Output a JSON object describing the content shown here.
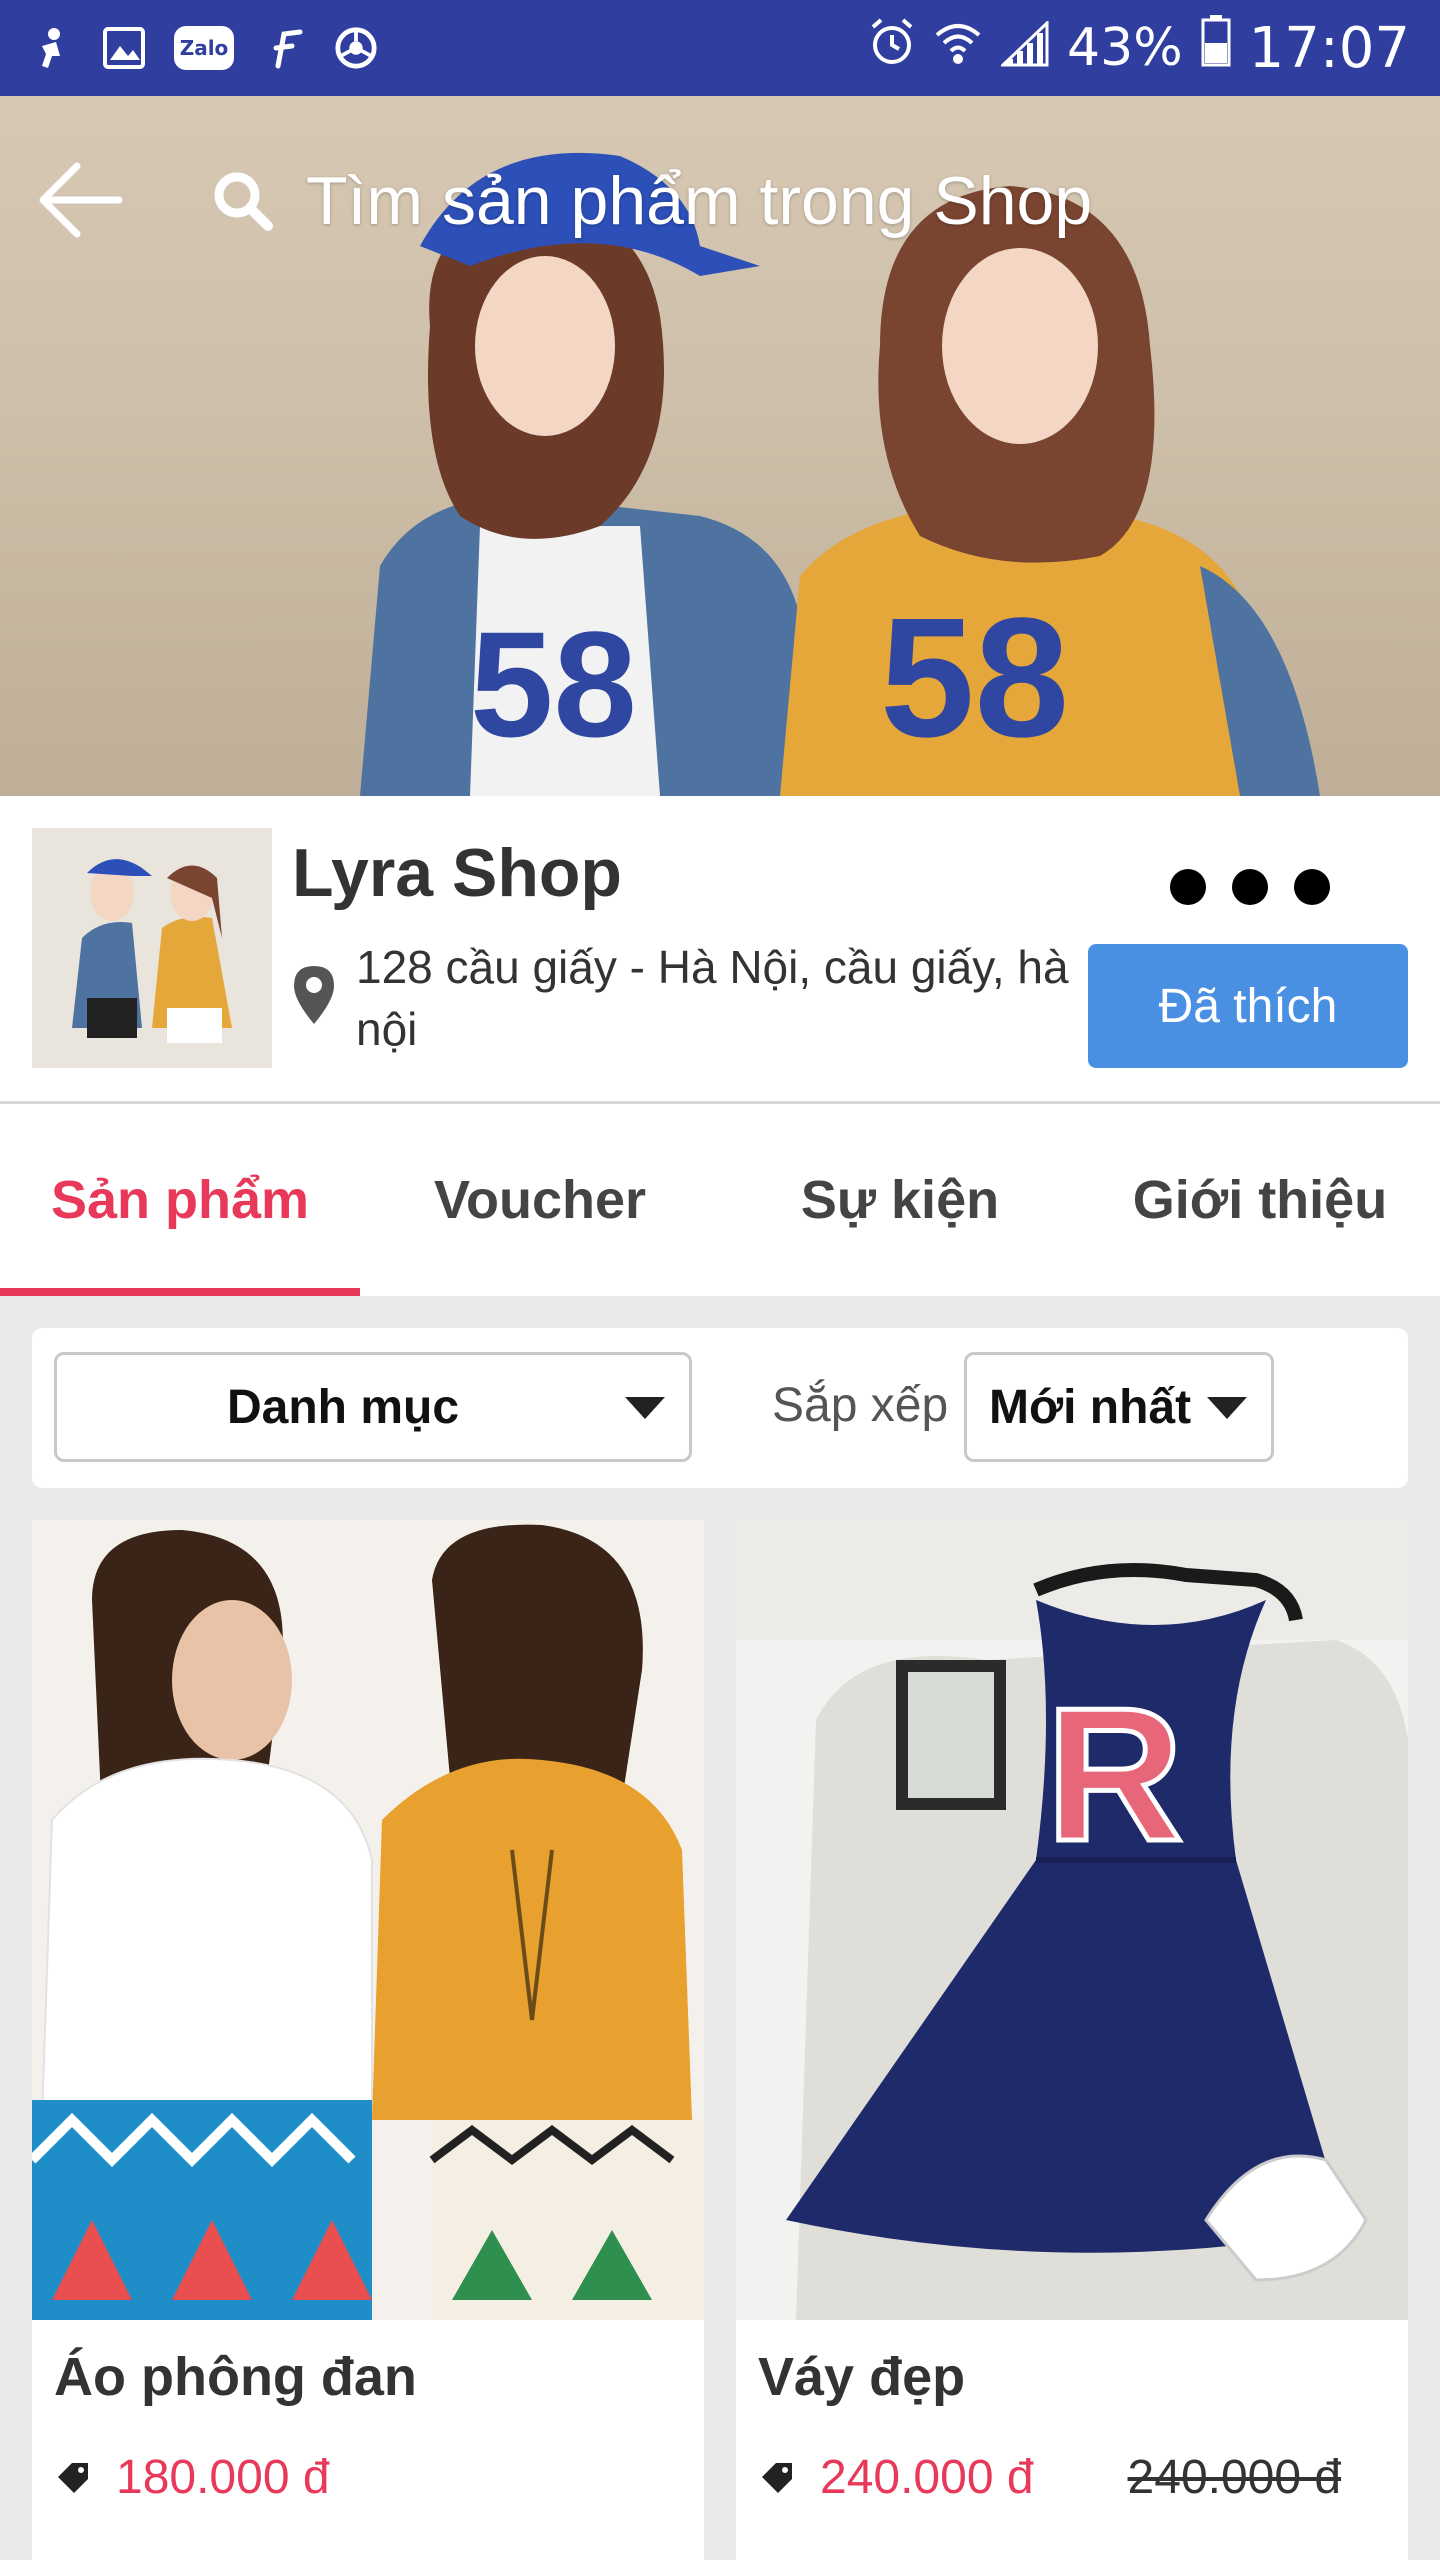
{
  "status_bar": {
    "battery_percent": "43%",
    "time": "17:07",
    "left_icons": [
      "notification-person-icon",
      "gallery-icon",
      "zalo-icon",
      "f-app-icon",
      "browser-icon"
    ],
    "zalo_label": "Zalo",
    "right_icons": [
      "alarm-icon",
      "wifi-icon",
      "signal-icon",
      "battery-icon"
    ]
  },
  "header": {
    "search_placeholder": "Tìm sản phẩm trong Shop"
  },
  "banner": {
    "jersey_number": "58"
  },
  "shop": {
    "name": "Lyra Shop",
    "address": "128 cầu giấy -  Hà Nội, cầu giấy, hà nội",
    "liked_label": "Đã thích"
  },
  "tabs": [
    {
      "label": "Sản phẩm",
      "active": true
    },
    {
      "label": "Voucher",
      "active": false
    },
    {
      "label": "Sự kiện",
      "active": false
    },
    {
      "label": "Giới thiệu",
      "active": false
    }
  ],
  "filter": {
    "category_label": "Danh mục",
    "sort_label": "Sắp xếp",
    "sort_value": "Mới nhất"
  },
  "products": [
    {
      "name": "Áo phông đan",
      "price": "180.000 đ",
      "old_price": ""
    },
    {
      "name": "Váy đẹp",
      "price": "240.000 đ",
      "old_price": "240.000 đ",
      "print_letter": "R"
    }
  ],
  "colors": {
    "status_bar": "#303f9f",
    "accent": "#e8395a",
    "liked_button": "#4a90e2"
  }
}
